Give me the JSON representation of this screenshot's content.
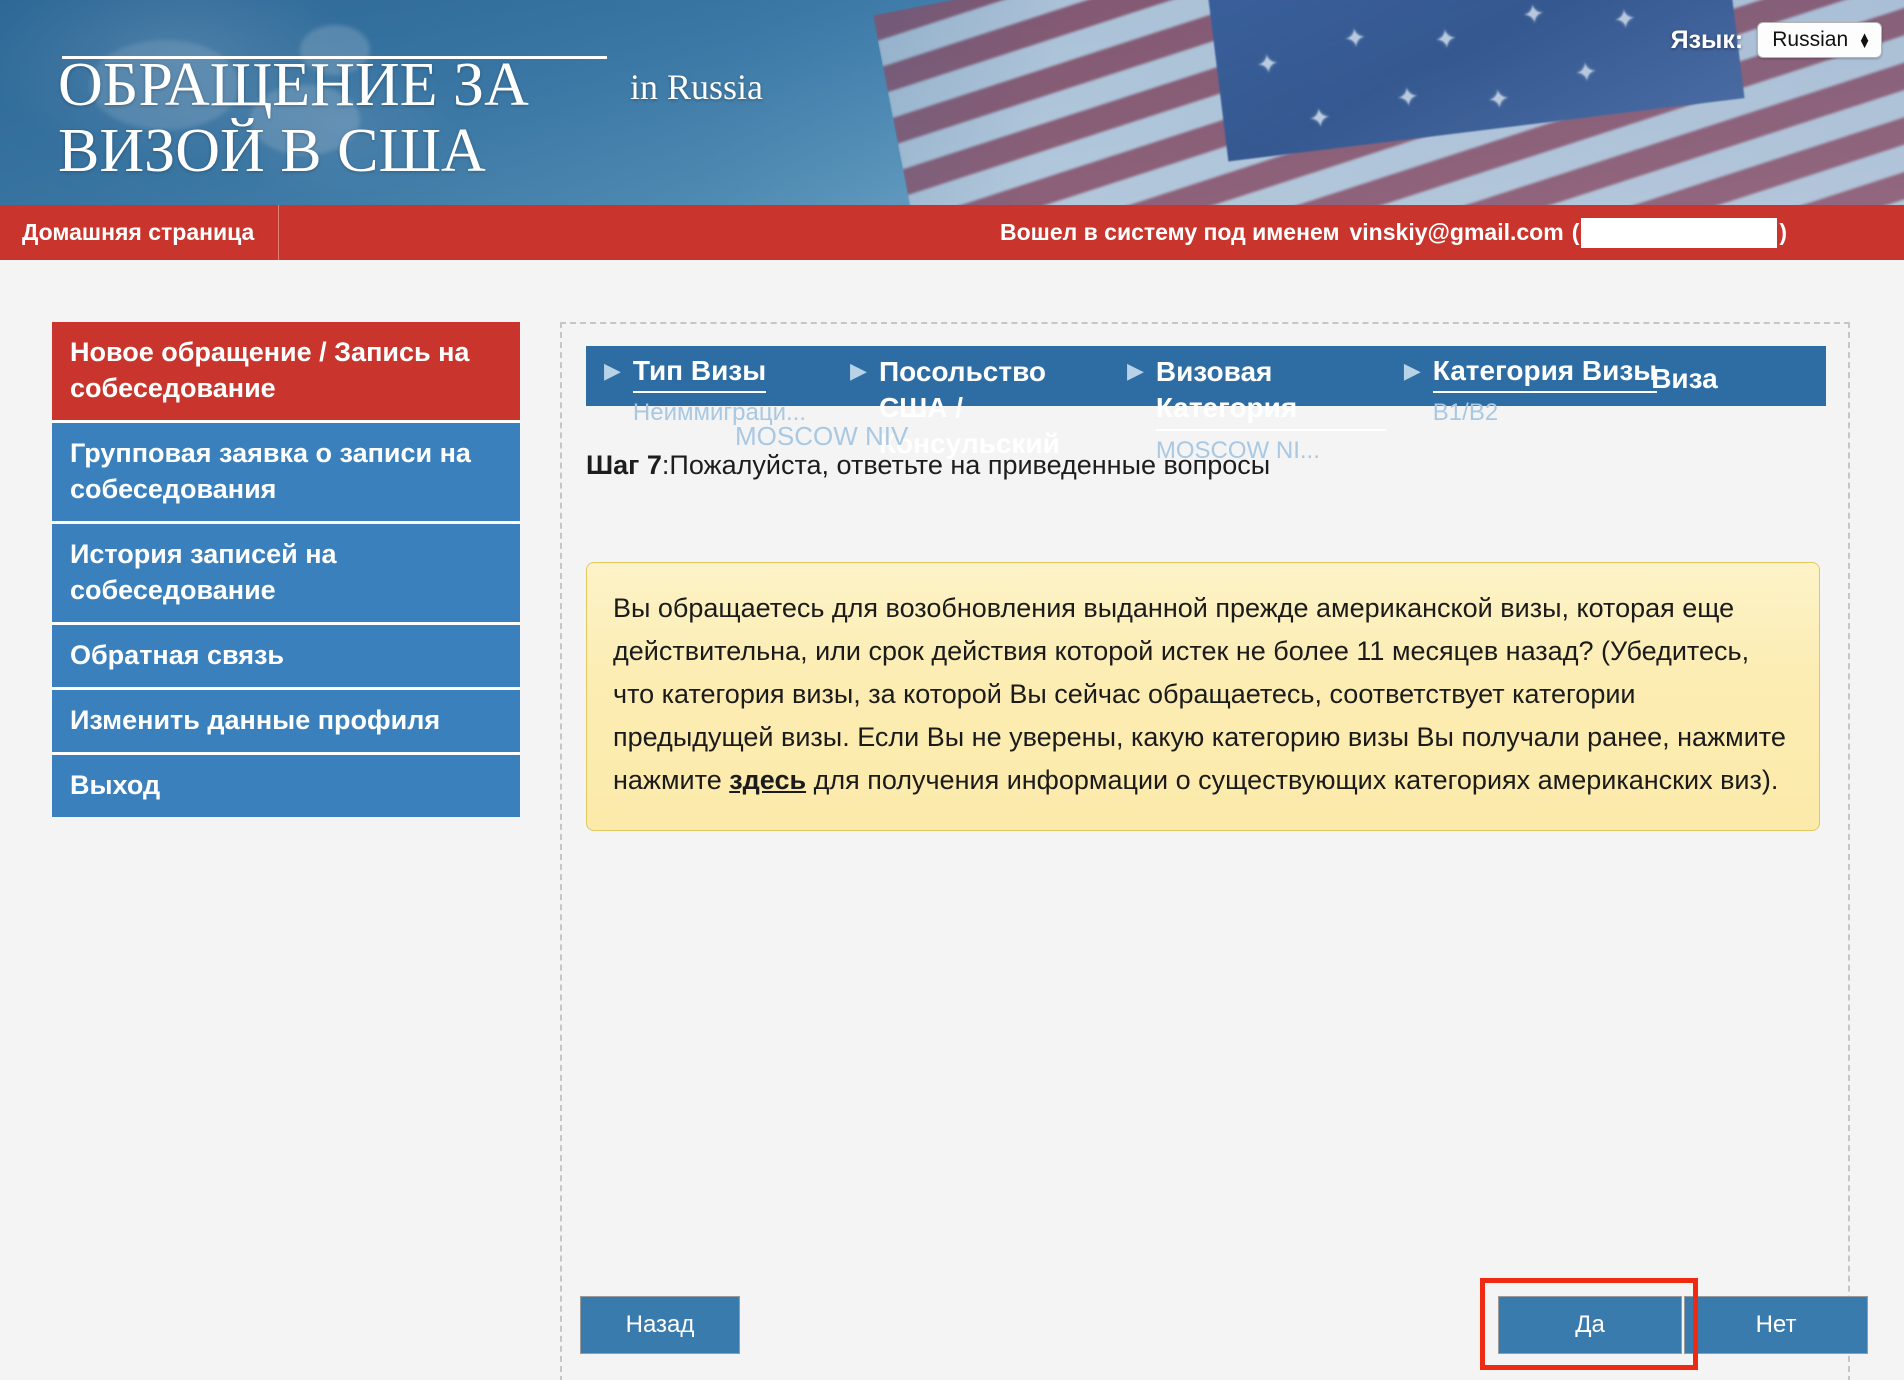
{
  "header": {
    "title": "ОБРАЩЕНИЕ ЗА\nВИЗОЙ В США",
    "subtitle": "in  Russia",
    "language_label": "Язык:",
    "language_value": "Russian"
  },
  "navbar": {
    "home_label": "Домашняя страница",
    "logged_in_prefix": "Вошел в систему под именем",
    "email": "vinskiy@gmail.com",
    "paren_open": "(",
    "paren_close": ")"
  },
  "sidebar": {
    "items": [
      {
        "label": "Новое обращение / Запись на собеседование",
        "active": true
      },
      {
        "label": "Групповая заявка о записи на собеседования",
        "active": false
      },
      {
        "label": "История записей на собеседование",
        "active": false
      },
      {
        "label": "Обратная связь",
        "active": false
      },
      {
        "label": "Изменить данные профиля",
        "active": false
      },
      {
        "label": "Выход",
        "active": false
      }
    ]
  },
  "breadcrumb": {
    "steps": [
      {
        "title": "Тип Визы",
        "sub": "Неиммиграци..."
      },
      {
        "title": "Посольство США / Консульский",
        "sub": ""
      },
      {
        "title": "Визовая Категория",
        "sub": "MOSCOW NI..."
      },
      {
        "title": "Категория Визы",
        "sub": "B1/B2"
      }
    ],
    "last_label": "Виза",
    "arrow_glyph": "▶"
  },
  "main": {
    "step_label": "Шаг 7",
    "step_text": ":Пожалуйста, ответьте на приведенные вопросы",
    "post_office": "MOSCOW NIV",
    "question_part1": "Вы обращаетесь для возобновления выданной прежде американской визы, которая еще действительна, или срок действия которой истек не более 11 месяцев назад? (Убедитесь, что категория визы, за которой Вы сейчас обращаетесь, соответствует  категории предыдущей визы. Если Вы не уверены,  какую категорию визы Вы получали  ранее,  нажмите нажмите ",
    "question_link": "здесь",
    "question_part2": " для получения информации о существующих категориях американских виз)."
  },
  "buttons": {
    "back": "Назад",
    "yes": "Да",
    "no": "Нет"
  },
  "colors": {
    "red": "#c9352c",
    "blue": "#3a80bd",
    "crumb_blue": "#2e6da4",
    "yellow": "#fcedb4",
    "highlight": "#ee2b12"
  }
}
